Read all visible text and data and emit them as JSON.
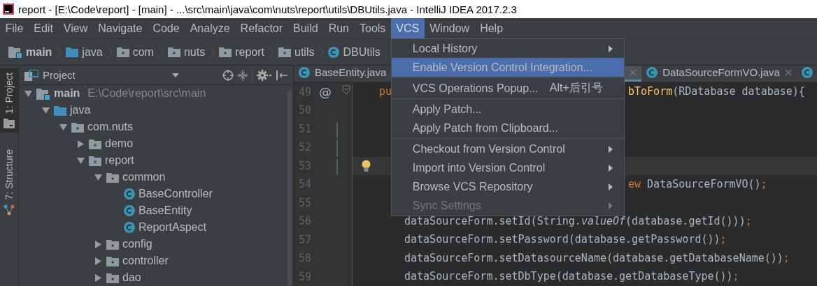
{
  "window": {
    "title": "report - [E:\\Code\\report] - [main] - ...\\src\\main\\java\\com\\nuts\\report\\utils\\DBUtils.java - IntelliJ IDEA 2017.2.3"
  },
  "menu_bar": [
    {
      "label": "File",
      "selected": false
    },
    {
      "label": "Edit",
      "selected": false
    },
    {
      "label": "View",
      "selected": false
    },
    {
      "label": "Navigate",
      "selected": false
    },
    {
      "label": "Code",
      "selected": false
    },
    {
      "label": "Analyze",
      "selected": false
    },
    {
      "label": "Refactor",
      "selected": false
    },
    {
      "label": "Build",
      "selected": false
    },
    {
      "label": "Run",
      "selected": false
    },
    {
      "label": "Tools",
      "selected": false
    },
    {
      "label": "VCS",
      "selected": true
    },
    {
      "label": "Window",
      "selected": false
    },
    {
      "label": "Help",
      "selected": false
    }
  ],
  "vcs_menu": {
    "groups": [
      [
        {
          "label": "Local History",
          "submenu": true,
          "selected": false,
          "disabled": false
        },
        {
          "label": "Enable Version Control Integration...",
          "submenu": false,
          "selected": true,
          "disabled": false
        }
      ],
      [
        {
          "label": "VCS Operations Popup...",
          "shortcut": "Alt+后引号",
          "submenu": false,
          "selected": false,
          "disabled": false
        }
      ],
      [
        {
          "label": "Apply Patch...",
          "submenu": false,
          "selected": false,
          "disabled": false
        },
        {
          "label": "Apply Patch from Clipboard...",
          "submenu": false,
          "selected": false,
          "disabled": false
        }
      ],
      [
        {
          "label": "Checkout from Version Control",
          "submenu": true,
          "selected": false,
          "disabled": false
        },
        {
          "label": "Import into Version Control",
          "submenu": true,
          "selected": false,
          "disabled": false
        },
        {
          "label": "Browse VCS Repository",
          "submenu": true,
          "selected": false,
          "disabled": false
        },
        {
          "label": "Sync Settings",
          "submenu": true,
          "selected": false,
          "disabled": true
        }
      ]
    ]
  },
  "breadcrumbs": [
    {
      "label": "main",
      "kind": "module"
    },
    {
      "label": "java",
      "kind": "source_folder"
    },
    {
      "label": "com",
      "kind": "package"
    },
    {
      "label": "nuts",
      "kind": "package"
    },
    {
      "label": "report",
      "kind": "package"
    },
    {
      "label": "utils",
      "kind": "package"
    },
    {
      "label": "DBUtils",
      "kind": "class"
    }
  ],
  "tool_stripe": [
    {
      "label": "1: Project",
      "kind": "project",
      "selected": true
    },
    {
      "label": "7: Structure",
      "kind": "structure",
      "selected": false
    }
  ],
  "project_panel": {
    "title": "Project",
    "tree": [
      {
        "label": "main",
        "path": "E:\\Code\\report\\src\\main",
        "kind": "module",
        "expanded": true,
        "children": [
          {
            "label": "java",
            "kind": "source_folder",
            "expanded": true,
            "children": [
              {
                "label": "com.nuts",
                "kind": "package",
                "expanded": true,
                "children": [
                  {
                    "label": "demo",
                    "kind": "package",
                    "expanded": false
                  },
                  {
                    "label": "report",
                    "kind": "package",
                    "expanded": true,
                    "children": [
                      {
                        "label": "common",
                        "kind": "package",
                        "expanded": true,
                        "children": [
                          {
                            "label": "BaseController",
                            "kind": "class"
                          },
                          {
                            "label": "BaseEntity",
                            "kind": "class"
                          },
                          {
                            "label": "ReportAspect",
                            "kind": "class"
                          }
                        ]
                      },
                      {
                        "label": "config",
                        "kind": "package",
                        "expanded": false
                      },
                      {
                        "label": "controller",
                        "kind": "package",
                        "expanded": false
                      },
                      {
                        "label": "dao",
                        "kind": "package",
                        "expanded": false
                      }
                    ]
                  }
                ]
              }
            ]
          }
        ]
      }
    ]
  },
  "editor": {
    "tabs": [
      {
        "label": "BaseEntity.java",
        "selected": false,
        "close_button": false
      },
      {
        "selected": true,
        "close_button": true
      },
      {
        "label": "DataSourceFormVO.java",
        "selected": false,
        "close_button": true
      },
      {
        "selected": false,
        "close_button": false
      }
    ],
    "lines": [
      {
        "number": "49",
        "kind": "declaration",
        "gutter_text": "@",
        "fold": true,
        "changed": false,
        "current": false,
        "bulb": false,
        "left": [
          {
            "text": "pu",
            "kind": "keyword"
          }
        ],
        "right": [
          {
            "text": "bToForm",
            "kind": "method"
          },
          {
            "text": "(RDatabase database){",
            "kind": "plain"
          }
        ]
      },
      {
        "number": "50",
        "fold": false,
        "changed": false,
        "current": false,
        "bulb": false
      },
      {
        "number": "51",
        "fold": false,
        "changed": true,
        "current": false,
        "bulb": false
      },
      {
        "number": "52",
        "fold": false,
        "changed": true,
        "current": false,
        "bulb": false
      },
      {
        "number": "53",
        "fold": false,
        "changed": true,
        "current": true,
        "bulb": true
      },
      {
        "number": "54",
        "fold": false,
        "changed": false,
        "current": false,
        "bulb": false,
        "right": [
          {
            "text": "ew",
            "kind": "keyword"
          },
          {
            "text": " DataSourceFormVO()",
            "kind": "plain"
          },
          {
            "text": ";",
            "kind": "keyword"
          }
        ]
      },
      {
        "number": "55",
        "fold": false,
        "changed": false,
        "current": false,
        "bulb": false
      },
      {
        "number": "56",
        "kind": "statement",
        "fold": false,
        "changed": false,
        "current": false,
        "bulb": false,
        "left": [
          {
            "text": "dataSourceForm.setId(String.",
            "kind": "plain"
          },
          {
            "text": "valueOf",
            "kind": "static"
          },
          {
            "text": "(database.getId()))",
            "kind": "plain"
          },
          {
            "text": ";",
            "kind": "keyword"
          }
        ]
      },
      {
        "number": "57",
        "kind": "statement",
        "fold": false,
        "changed": false,
        "current": false,
        "bulb": false,
        "left": [
          {
            "text": "dataSourceForm.setPassword(database.getPassword())",
            "kind": "plain"
          },
          {
            "text": ";",
            "kind": "keyword"
          }
        ]
      },
      {
        "number": "58",
        "kind": "statement",
        "fold": false,
        "changed": false,
        "current": false,
        "bulb": false,
        "left": [
          {
            "text": "dataSourceForm.setDatasourceName(database.getDatabaseName())",
            "kind": "plain"
          },
          {
            "text": ";",
            "kind": "keyword"
          }
        ]
      },
      {
        "number": "59",
        "kind": "statement",
        "fold": false,
        "changed": false,
        "current": false,
        "bulb": false,
        "left": [
          {
            "text": "dataSourceForm.setDbType(database.getDatabaseType())",
            "kind": "plain"
          },
          {
            "text": ";",
            "kind": "keyword"
          }
        ]
      }
    ]
  }
}
